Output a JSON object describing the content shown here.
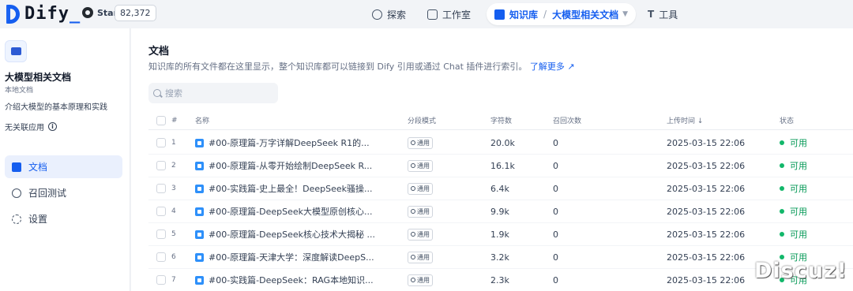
{
  "header": {
    "logo_text": "Dify",
    "github_label": "Star",
    "star_count": "82,372",
    "nav": {
      "explore": "探索",
      "studio": "工作室",
      "knowledge": "知识库",
      "separator": "/",
      "current_kb": "大模型相关文档",
      "tools": "工具"
    }
  },
  "sidebar": {
    "kb_name": "大模型相关文档",
    "kb_type": "本地文档",
    "kb_desc": "介绍大模型的基本原理和实践",
    "no_app": "无关联应用",
    "items": [
      {
        "label": "文档",
        "icon": "document-icon",
        "active": true
      },
      {
        "label": "召回测试",
        "icon": "target-icon",
        "active": false
      },
      {
        "label": "设置",
        "icon": "gear-icon",
        "active": false
      }
    ]
  },
  "main": {
    "title": "文档",
    "subtitle": "知识库的所有文件都在这里显示，整个知识库都可以链接到 Dify 引用或通过 Chat 插件进行索引。",
    "learn_more": "了解更多",
    "search_placeholder": "搜索",
    "columns": {
      "index": "#",
      "name": "名称",
      "mode": "分段模式",
      "chars": "字符数",
      "recall": "召回次数",
      "upload_time": "上传时间 ↓",
      "status": "状态"
    },
    "rows": [
      {
        "index": "1",
        "name": "#00-原理篇-万字详解DeepSeek R1的...",
        "mode": "通用",
        "chars": "20.0k",
        "recall": "0",
        "time": "2025-03-15 22:06",
        "status": "可用"
      },
      {
        "index": "2",
        "name": "#00-原理篇-从零开始绘制DeepSeek R...",
        "mode": "通用",
        "chars": "16.1k",
        "recall": "0",
        "time": "2025-03-15 22:06",
        "status": "可用"
      },
      {
        "index": "3",
        "name": "#00-实践篇-史上最全！DeepSeek骚操...",
        "mode": "通用",
        "chars": "6.4k",
        "recall": "0",
        "time": "2025-03-15 22:06",
        "status": "可用"
      },
      {
        "index": "4",
        "name": "#00-原理篇-DeepSeek大模型原创核心...",
        "mode": "通用",
        "chars": "9.9k",
        "recall": "0",
        "time": "2025-03-15 22:06",
        "status": "可用"
      },
      {
        "index": "5",
        "name": "#00-原理篇-DeepSeek核心技术大揭秘 ...",
        "mode": "通用",
        "chars": "1.9k",
        "recall": "0",
        "time": "2025-03-15 22:06",
        "status": "可用"
      },
      {
        "index": "6",
        "name": "#00-原理篇-天津大学：深度解读DeepS...",
        "mode": "通用",
        "chars": "3.2k",
        "recall": "0",
        "time": "2025-03-15 22:06",
        "status": "可用"
      },
      {
        "index": "7",
        "name": "#00-实践篇-DeepSeek：RAG本地知识...",
        "mode": "通用",
        "chars": "2.3k",
        "recall": "0",
        "time": "2025-03-15 22:06",
        "status": "可用"
      }
    ]
  },
  "watermark": "Discuz!",
  "colors": {
    "accent": "#155eef",
    "status_ok": "#12b76a"
  }
}
